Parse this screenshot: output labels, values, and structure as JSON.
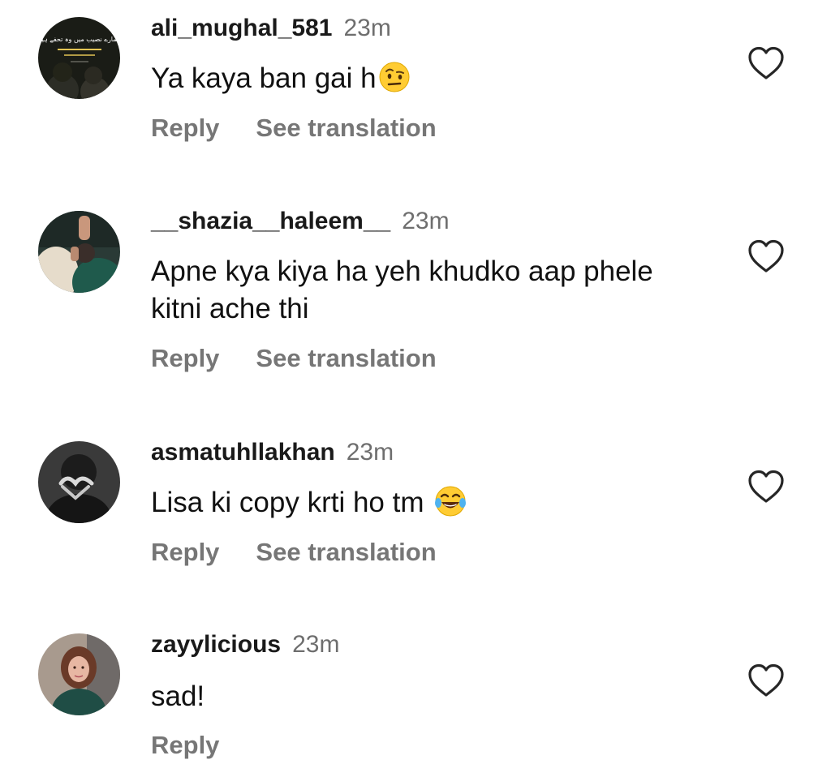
{
  "comments": [
    {
      "username": "ali_mughal_581",
      "time": "23m",
      "text": "Ya kaya ban gai h",
      "emoji": "face-with-raised-eyebrow-emoji",
      "avatar_overlay_text": "ہمارے نصیب میں وہ تحفے ہیں",
      "reply_label": "Reply",
      "translate_label": "See translation"
    },
    {
      "username": "__shazia__haleem__",
      "time": "23m",
      "text": "Apne kya kiya ha yeh khudko aap phele kitni ache thi",
      "reply_label": "Reply",
      "translate_label": "See translation"
    },
    {
      "username": "asmatuhllakhan",
      "time": "23m",
      "text": "Lisa ki copy krti ho tm",
      "emoji": "face-with-tears-of-joy-emoji",
      "reply_label": "Reply",
      "translate_label": "See translation"
    },
    {
      "username": "zayylicious",
      "time": "23m",
      "text": "sad!",
      "reply_label": "Reply"
    }
  ],
  "icons": {
    "like": "heart-outline-icon"
  },
  "colors": {
    "text": "#111111",
    "meta": "#6e6e6e",
    "action": "#767676",
    "heart_stroke": "#262626"
  }
}
